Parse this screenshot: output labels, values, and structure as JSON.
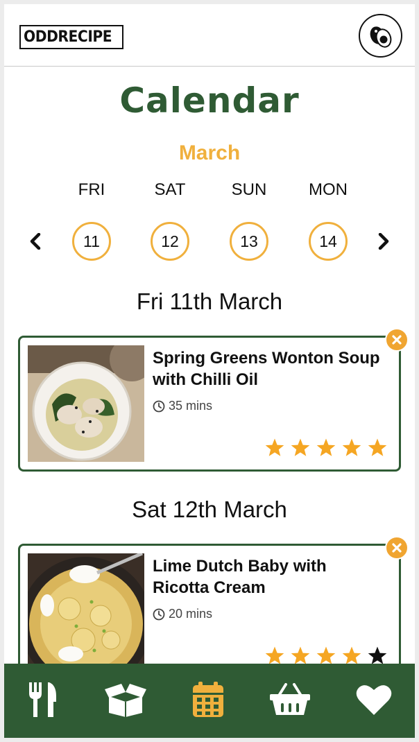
{
  "header": {
    "logo_text": "ODDRECIPE",
    "avatar_icon": "avocado-icon"
  },
  "page": {
    "title": "Calendar",
    "month": "March"
  },
  "week": {
    "days": [
      {
        "name": "FRI",
        "date": "11"
      },
      {
        "name": "SAT",
        "date": "12"
      },
      {
        "name": "SUN",
        "date": "13"
      },
      {
        "name": "MON",
        "date": "14"
      }
    ],
    "prev_icon": "chevron-left-icon",
    "next_icon": "chevron-right-icon"
  },
  "schedule": [
    {
      "heading": "Fri 11th March",
      "recipe": {
        "title_line1": "Spring Greens Wonton Soup",
        "title_line2": "with Chilli Oil",
        "time": "35 mins",
        "rating": 5,
        "rating_max": 5
      }
    },
    {
      "heading": "Sat 12th March",
      "recipe": {
        "title_line1": "Lime Dutch Baby with",
        "title_line2": "Ricotta Cream",
        "time": "20 mins",
        "rating": 4,
        "rating_max": 5
      }
    }
  ],
  "bottom_nav": {
    "items": [
      {
        "icon": "fork-knife-icon",
        "active": false
      },
      {
        "icon": "box-icon",
        "active": false
      },
      {
        "icon": "calendar-icon",
        "active": true
      },
      {
        "icon": "basket-icon",
        "active": false
      },
      {
        "icon": "heart-icon",
        "active": false
      }
    ]
  },
  "colors": {
    "brand_green": "#2f5b34",
    "accent_orange": "#f0b03d",
    "star_orange": "#f5a623",
    "star_empty": "#111111"
  }
}
